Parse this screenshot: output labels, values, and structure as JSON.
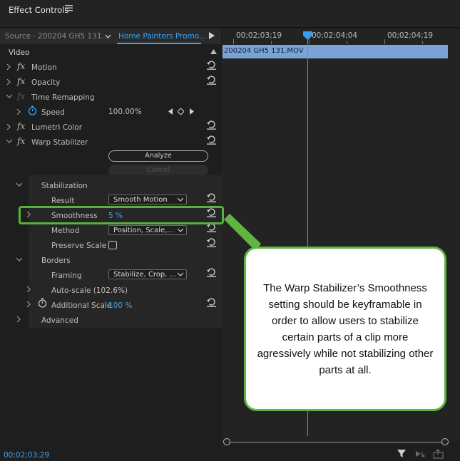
{
  "panel": {
    "title": "Effect Controls"
  },
  "tabs": {
    "source": "Source · 200204 GH5 131...",
    "sequence": "Home Painters Promo..."
  },
  "timeline": {
    "ruler": [
      "00;02;03;19",
      "00;02;04;04",
      "00;02;04;19"
    ],
    "clip_name": "200204 GH5 131.MOV"
  },
  "video_header": "Video",
  "effects": {
    "motion": "Motion",
    "opacity": "Opacity",
    "time_remapping": "Time Remapping",
    "speed": {
      "label": "Speed",
      "value": "100.00%"
    },
    "lumetri": "Lumetri Color",
    "warp": "Warp Stabilizer"
  },
  "warp": {
    "analyze_label": "Analyze",
    "cancel_label": "Cancel",
    "stabilization": "Stabilization",
    "result": {
      "label": "Result",
      "value": "Smooth Motion"
    },
    "smoothness": {
      "label": "Smoothness",
      "value": "5 %"
    },
    "method": {
      "label": "Method",
      "value": "Position, Scale,..."
    },
    "preserve_scale": "Preserve Scale",
    "borders": "Borders",
    "framing": {
      "label": "Framing",
      "value": "Stabilize, Crop, ..."
    },
    "auto_scale": "Auto-scale (102.6%)",
    "additional_scale": {
      "label": "Additional Scale",
      "value": "100 %"
    },
    "advanced": "Advanced"
  },
  "callout": {
    "text": "The Warp Stabilizer’s Smoothness setting should be keyframable in order to allow users to stabilize certain parts of a clip more agressively while not stabilizing other parts at all."
  },
  "status": {
    "timecode": "00;02;03;29"
  },
  "colors": {
    "accent": "#3aa5f4",
    "callout_border": "#5fb53f",
    "clip": "#7aa4d6"
  },
  "icons": [
    "hamburger-menu-icon",
    "chevron-down-icon",
    "play-icon",
    "fx-icon",
    "reset-icon",
    "stopwatch-icon",
    "keyframe-icon",
    "filter-icon",
    "export-frame-icon"
  ]
}
